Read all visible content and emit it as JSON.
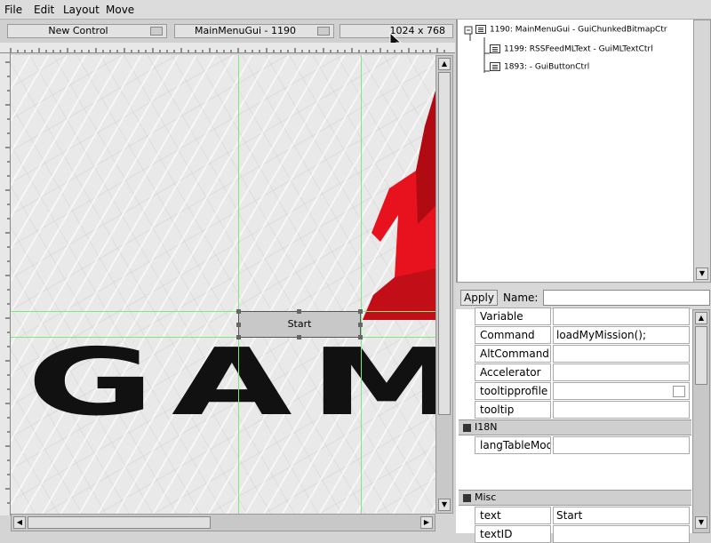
{
  "menubar": {
    "items": [
      "File",
      "Edit",
      "Layout",
      "Move"
    ]
  },
  "toolbar": {
    "new_control": "New Control",
    "gui_name": "MainMenuGui - 1190",
    "resolution": "1024 x 768"
  },
  "canvas": {
    "start_button_label": "Start",
    "logo_text": "GAM"
  },
  "tree": {
    "root": "1190: MainMenuGui - GuiChunkedBitmapCtr",
    "children": [
      "1199: RSSFeedMLText - GuiMLTextCtrl",
      "1893:  - GuiButtonCtrl"
    ]
  },
  "namebar": {
    "apply": "Apply",
    "name_label": "Name:",
    "name_value": ""
  },
  "inspector": {
    "rows": [
      {
        "key": "Variable",
        "value": ""
      },
      {
        "key": "Command",
        "value": "loadMyMission();"
      },
      {
        "key": "AltCommand",
        "value": ""
      },
      {
        "key": "Accelerator",
        "value": ""
      },
      {
        "key": "tooltipprofile",
        "value": ""
      },
      {
        "key": "tooltip",
        "value": ""
      }
    ],
    "section_i18n": "I18N",
    "i18n_rows": [
      {
        "key": "langTableMod",
        "value": ""
      }
    ],
    "section_misc": "Misc",
    "misc_rows": [
      {
        "key": "text",
        "value": "Start"
      },
      {
        "key": "textID",
        "value": ""
      }
    ]
  },
  "colors": {
    "logo_red": "#e8121e",
    "logo_black": "#111111",
    "guide_green": "#7ee87e"
  }
}
